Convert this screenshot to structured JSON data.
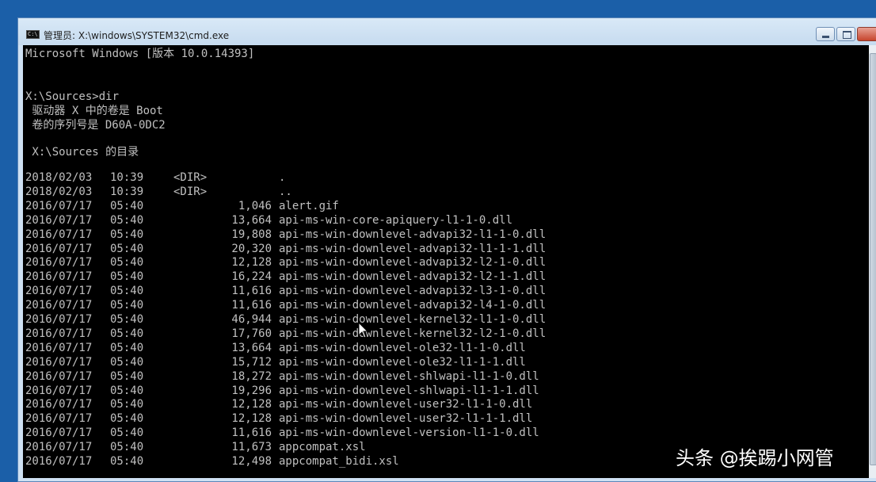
{
  "window": {
    "icon_text": "C:\\",
    "title": "管理员: X:\\windows\\SYSTEM32\\cmd.exe"
  },
  "console": {
    "header": "Microsoft Windows [版本 10.0.14393]",
    "prompt": "X:\\Sources>dir",
    "volume_line": " 驱动器 X 中的卷是 Boot",
    "serial_line": " 卷的序列号是 D60A-0DC2",
    "dir_of": " X:\\Sources 的目录",
    "entries": [
      {
        "date": "2018/02/03",
        "time": "10:39",
        "dir": "<DIR>",
        "size": "",
        "name": "."
      },
      {
        "date": "2018/02/03",
        "time": "10:39",
        "dir": "<DIR>",
        "size": "",
        "name": ".."
      },
      {
        "date": "2016/07/17",
        "time": "05:40",
        "dir": "",
        "size": "1,046",
        "name": "alert.gif"
      },
      {
        "date": "2016/07/17",
        "time": "05:40",
        "dir": "",
        "size": "13,664",
        "name": "api-ms-win-core-apiquery-l1-1-0.dll"
      },
      {
        "date": "2016/07/17",
        "time": "05:40",
        "dir": "",
        "size": "19,808",
        "name": "api-ms-win-downlevel-advapi32-l1-1-0.dll"
      },
      {
        "date": "2016/07/17",
        "time": "05:40",
        "dir": "",
        "size": "20,320",
        "name": "api-ms-win-downlevel-advapi32-l1-1-1.dll"
      },
      {
        "date": "2016/07/17",
        "time": "05:40",
        "dir": "",
        "size": "12,128",
        "name": "api-ms-win-downlevel-advapi32-l2-1-0.dll"
      },
      {
        "date": "2016/07/17",
        "time": "05:40",
        "dir": "",
        "size": "16,224",
        "name": "api-ms-win-downlevel-advapi32-l2-1-1.dll"
      },
      {
        "date": "2016/07/17",
        "time": "05:40",
        "dir": "",
        "size": "11,616",
        "name": "api-ms-win-downlevel-advapi32-l3-1-0.dll"
      },
      {
        "date": "2016/07/17",
        "time": "05:40",
        "dir": "",
        "size": "11,616",
        "name": "api-ms-win-downlevel-advapi32-l4-1-0.dll"
      },
      {
        "date": "2016/07/17",
        "time": "05:40",
        "dir": "",
        "size": "46,944",
        "name": "api-ms-win-downlevel-kernel32-l1-1-0.dll"
      },
      {
        "date": "2016/07/17",
        "time": "05:40",
        "dir": "",
        "size": "17,760",
        "name": "api-ms-win-downlevel-kernel32-l2-1-0.dll"
      },
      {
        "date": "2016/07/17",
        "time": "05:40",
        "dir": "",
        "size": "13,664",
        "name": "api-ms-win-downlevel-ole32-l1-1-0.dll"
      },
      {
        "date": "2016/07/17",
        "time": "05:40",
        "dir": "",
        "size": "15,712",
        "name": "api-ms-win-downlevel-ole32-l1-1-1.dll"
      },
      {
        "date": "2016/07/17",
        "time": "05:40",
        "dir": "",
        "size": "18,272",
        "name": "api-ms-win-downlevel-shlwapi-l1-1-0.dll"
      },
      {
        "date": "2016/07/17",
        "time": "05:40",
        "dir": "",
        "size": "19,296",
        "name": "api-ms-win-downlevel-shlwapi-l1-1-1.dll"
      },
      {
        "date": "2016/07/17",
        "time": "05:40",
        "dir": "",
        "size": "12,128",
        "name": "api-ms-win-downlevel-user32-l1-1-0.dll"
      },
      {
        "date": "2016/07/17",
        "time": "05:40",
        "dir": "",
        "size": "12,128",
        "name": "api-ms-win-downlevel-user32-l1-1-1.dll"
      },
      {
        "date": "2016/07/17",
        "time": "05:40",
        "dir": "",
        "size": "11,616",
        "name": "api-ms-win-downlevel-version-l1-1-0.dll"
      },
      {
        "date": "2016/07/17",
        "time": "05:40",
        "dir": "",
        "size": "11,673",
        "name": "appcompat.xsl"
      },
      {
        "date": "2016/07/17",
        "time": "05:40",
        "dir": "",
        "size": "12,498",
        "name": "appcompat_bidi.xsl"
      }
    ]
  },
  "overlay": {
    "watermark": "头条 @挨踢小网管"
  },
  "colors": {
    "desktop": "#1b5fa8",
    "console_bg": "#000000",
    "console_fg": "#c0c0c0"
  },
  "icons": {
    "cursor": "mouse-pointer-icon"
  }
}
